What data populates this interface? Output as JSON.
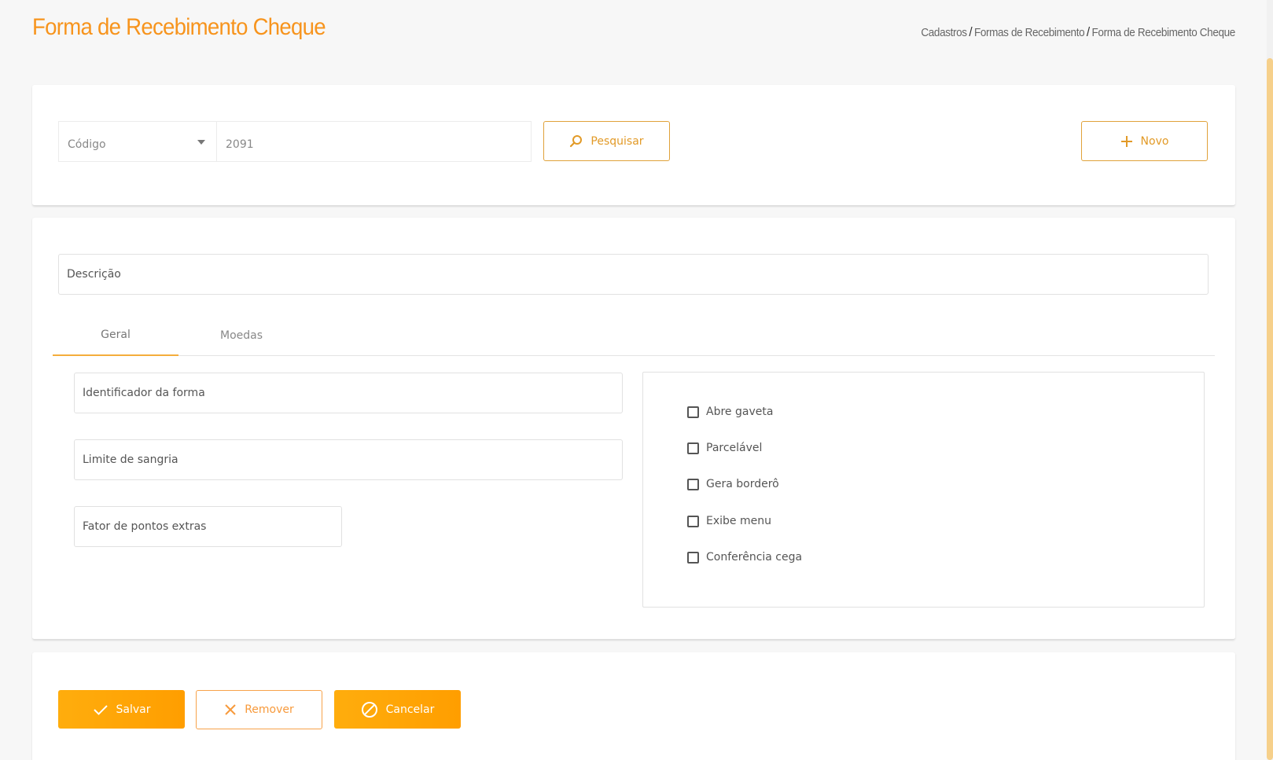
{
  "header": {
    "title": "Forma de Recebimento Cheque",
    "breadcrumb": [
      "Cadastros",
      "Formas de Recebimento",
      "Forma de Recebimento Cheque"
    ],
    "separator": "/"
  },
  "search": {
    "select_value": "Código",
    "code_value": "2091",
    "pesquisar_label": "Pesquisar",
    "novo_label": "Novo"
  },
  "form": {
    "descricao_label": "Descrição",
    "tabs": [
      {
        "label": "Geral",
        "active": true
      },
      {
        "label": "Moedas",
        "active": false
      }
    ],
    "identificador_label": "Identificador da forma",
    "limite_label": "Limite de sangria",
    "fator_label": "Fator de pontos extras",
    "checkboxes": [
      {
        "label": "Abre gaveta",
        "checked": false
      },
      {
        "label": "Parcelável",
        "checked": false
      },
      {
        "label": "Gera borderô",
        "checked": false
      },
      {
        "label": "Exibe menu",
        "checked": false
      },
      {
        "label": "Conferência cega",
        "checked": false
      }
    ]
  },
  "actions": {
    "salvar_label": "Salvar",
    "remover_label": "Remover",
    "cancelar_label": "Cancelar"
  },
  "colors": {
    "accent": "#f7941d",
    "button_gradient_start": "#ffad0d",
    "button_gradient_end": "#ff9e00",
    "tab_underline": "#f4ad3c"
  },
  "icons": {
    "pesquisar": "search-icon",
    "novo": "plus-icon",
    "salvar": "check-icon",
    "remover": "close-icon",
    "cancelar": "ban-icon",
    "select": "chevron-down-icon"
  }
}
